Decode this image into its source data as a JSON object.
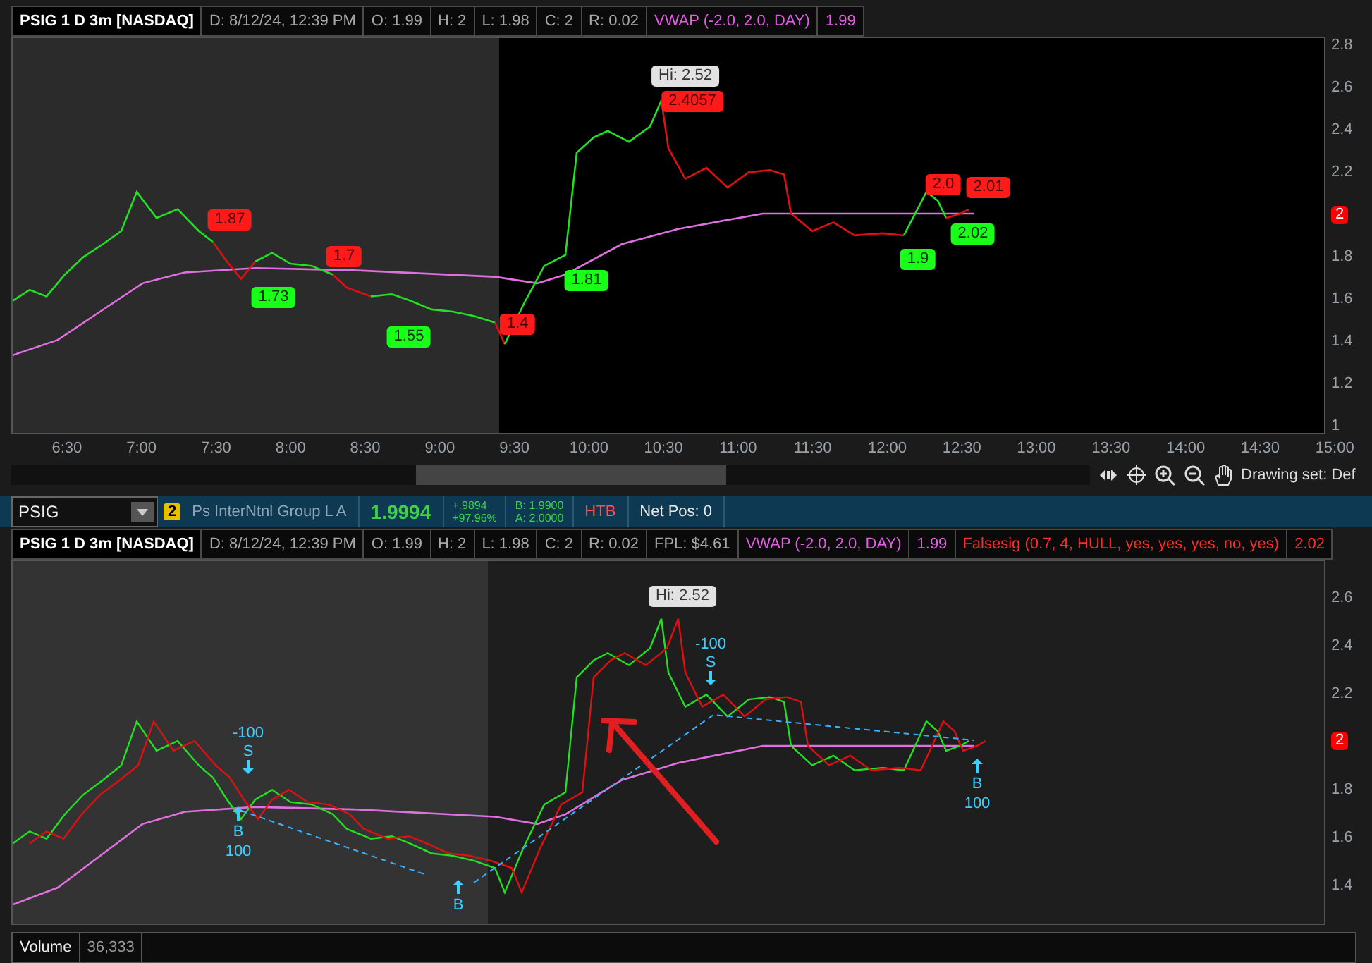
{
  "top_chart": {
    "header": {
      "symbol": "PSIG 1 D 3m [NASDAQ]",
      "fields": [
        "D: 8/12/24, 12:39 PM",
        "O: 1.99",
        "H: 2",
        "L: 1.98",
        "C: 2",
        "R: 0.02"
      ],
      "studies": [
        {
          "label": "VWAP (-2.0, 2.0, DAY)",
          "value": "1.99",
          "color": "#e85ae8"
        }
      ]
    },
    "y_ticks": [
      {
        "kind": "tick",
        "label": "2.8"
      },
      {
        "kind": "tick",
        "label": "2.6"
      },
      {
        "kind": "tick",
        "label": "2.4"
      },
      {
        "kind": "tick",
        "label": "2.2"
      },
      {
        "kind": "tag",
        "label": "2"
      },
      {
        "kind": "tick",
        "label": "1.8"
      },
      {
        "kind": "tick",
        "label": "1.6"
      },
      {
        "kind": "tick",
        "label": "1.4"
      },
      {
        "kind": "tick",
        "label": "1.2"
      },
      {
        "kind": "tick",
        "label": "1"
      }
    ],
    "callouts": [
      {
        "kind": "high",
        "text": "Hi: 2.52"
      },
      {
        "kind": "sell",
        "text": "2.4057"
      },
      {
        "kind": "sell",
        "text": "1.87"
      },
      {
        "kind": "buy",
        "text": "1.73"
      },
      {
        "kind": "sell",
        "text": "1.7"
      },
      {
        "kind": "buy",
        "text": "1.55"
      },
      {
        "kind": "sell",
        "text": "1.4"
      },
      {
        "kind": "buy",
        "text": "1.81"
      },
      {
        "kind": "buy",
        "text": "1.9"
      },
      {
        "kind": "sell",
        "text": "2.0"
      },
      {
        "kind": "sell",
        "text": "2.01"
      },
      {
        "kind": "buy",
        "text": "2.02"
      }
    ],
    "x_ticks": [
      "6:30",
      "7:00",
      "7:30",
      "8:00",
      "8:30",
      "9:00",
      "9:30",
      "10:00",
      "10:30",
      "11:00",
      "11:30",
      "12:00",
      "12:30",
      "13:00",
      "13:30",
      "14:00",
      "14:30",
      "15:00"
    ]
  },
  "scrollbar": {
    "drawing_set": "Drawing set: Def"
  },
  "toolbar": {
    "symbol": "PSIG",
    "badge": "2",
    "company": "Ps InterNtnl Group L A",
    "last": "1.9994",
    "change": "+.9894",
    "change_pct": "+97.96%",
    "bid": "B: 1.9900",
    "ask": "A: 2.0000",
    "htb": "HTB",
    "net_pos": "Net Pos: 0"
  },
  "bottom_chart": {
    "header": {
      "symbol": "PSIG 1 D 3m [NASDAQ]",
      "fields": [
        "D: 8/12/24, 12:39 PM",
        "O: 1.99",
        "H: 2",
        "L: 1.98",
        "C: 2",
        "R: 0.02",
        "FPL: $4.61"
      ],
      "studies": [
        {
          "label": "VWAP (-2.0, 2.0, DAY)",
          "value": "1.99",
          "color": "#e85ae8"
        },
        {
          "label": "Falsesig (0.7, 4, HULL, yes, yes, yes, no, yes)",
          "value": "2.02",
          "color": "#ff2a2a"
        }
      ]
    },
    "y_ticks": [
      {
        "kind": "tick",
        "label": "2.6"
      },
      {
        "kind": "tick",
        "label": "2.4"
      },
      {
        "kind": "tick",
        "label": "2.2"
      },
      {
        "kind": "tag",
        "label": "2"
      },
      {
        "kind": "tick",
        "label": "1.8"
      },
      {
        "kind": "tick",
        "label": "1.6"
      },
      {
        "kind": "tick",
        "label": "1.4"
      }
    ],
    "callouts": [
      {
        "kind": "high",
        "text": "Hi: 2.52"
      }
    ],
    "trades": [
      {
        "kind": "sell",
        "side": "S",
        "qty": "-100"
      },
      {
        "kind": "buy",
        "side": "B",
        "qty": "100"
      },
      {
        "kind": "buy",
        "side": "B"
      },
      {
        "kind": "sell",
        "side": "S",
        "qty": "-100"
      },
      {
        "kind": "buy",
        "side": "B",
        "qty": "100"
      }
    ]
  },
  "volume": {
    "label": "Volume",
    "value": "36,333"
  }
}
